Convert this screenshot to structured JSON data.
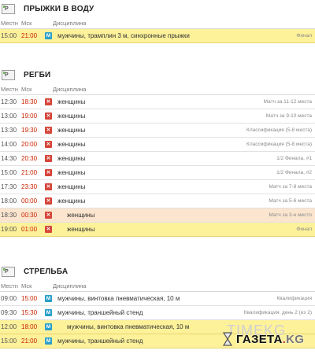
{
  "columns": {
    "local": "Местн",
    "msk": "Мск",
    "discipline": "Дисциплина"
  },
  "sections": [
    {
      "icon": "P",
      "title": "ПРЫЖКИ В ВОДУ",
      "rows": [
        {
          "local": "15:00",
          "msk": "21:00",
          "badge": "M",
          "discipline": "мужчины, трамплин 3 м, синхронные прыжки",
          "stage": "Финал",
          "style": "hl"
        }
      ]
    },
    {
      "icon": "P",
      "title": "РЕГБИ",
      "rows": [
        {
          "local": "12:30",
          "msk": "18:30",
          "badge": "Ж",
          "discipline": "женщины",
          "stage": "Матч за 11-12 места",
          "style": ""
        },
        {
          "local": "13:00",
          "msk": "19:00",
          "badge": "Ж",
          "discipline": "женщины",
          "stage": "Матч за 9-10 места",
          "style": ""
        },
        {
          "local": "13:30",
          "msk": "19:30",
          "badge": "Ж",
          "discipline": "женщины",
          "stage": "Классификация (5-8 места)",
          "style": ""
        },
        {
          "local": "14:00",
          "msk": "20:00",
          "badge": "Ж",
          "discipline": "женщины",
          "stage": "Классификация (5-8 места)",
          "style": ""
        },
        {
          "local": "14:30",
          "msk": "20:30",
          "badge": "Ж",
          "discipline": "женщины",
          "stage": "1/2 Финала, #1",
          "style": ""
        },
        {
          "local": "15:00",
          "msk": "21:00",
          "badge": "Ж",
          "discipline": "женщины",
          "stage": "1/2 Финала, #2",
          "style": ""
        },
        {
          "local": "17:30",
          "msk": "23:30",
          "badge": "Ж",
          "discipline": "женщины",
          "stage": "Матч за 7-8 места",
          "style": ""
        },
        {
          "local": "18:00",
          "msk": "00:00",
          "badge": "Ж",
          "discipline": "женщины",
          "stage": "Матч за 5-6 места",
          "style": ""
        },
        {
          "local": "18:30",
          "msk": "00:30",
          "badge": "Ж",
          "discipline": "женщины",
          "stage": "Матч за 3-е место",
          "style": "live indent"
        },
        {
          "local": "19:00",
          "msk": "01:00",
          "badge": "Ж",
          "discipline": "женщины",
          "stage": "Финал",
          "style": "hl indent"
        }
      ]
    },
    {
      "icon": "P",
      "title": "СТРЕЛЬБА",
      "rows": [
        {
          "local": "09:00",
          "msk": "15:00",
          "badge": "M",
          "discipline": "мужчины, винтовка пневматическая, 10 м",
          "stage": "Квалификация",
          "style": ""
        },
        {
          "local": "09:30",
          "msk": "15:30",
          "badge": "M",
          "discipline": "мужчины, траншейный стенд",
          "stage": "Квалификация, день 2 (из 2)",
          "style": ""
        },
        {
          "local": "12:00",
          "msk": "18:00",
          "badge": "M",
          "discipline": "мужчины, винтовка пневматическая, 10 м",
          "stage": "",
          "style": "hl indent"
        },
        {
          "local": "15:00",
          "msk": "21:00",
          "badge": "M",
          "discipline": "мужчины, траншейный стенд",
          "stage": "",
          "style": "hl"
        }
      ]
    }
  ],
  "watermark": {
    "gray": "TIMEKG",
    "logo_main": "ГАЗЕТА",
    "logo_dot": ".",
    "logo_kg": "KG"
  }
}
